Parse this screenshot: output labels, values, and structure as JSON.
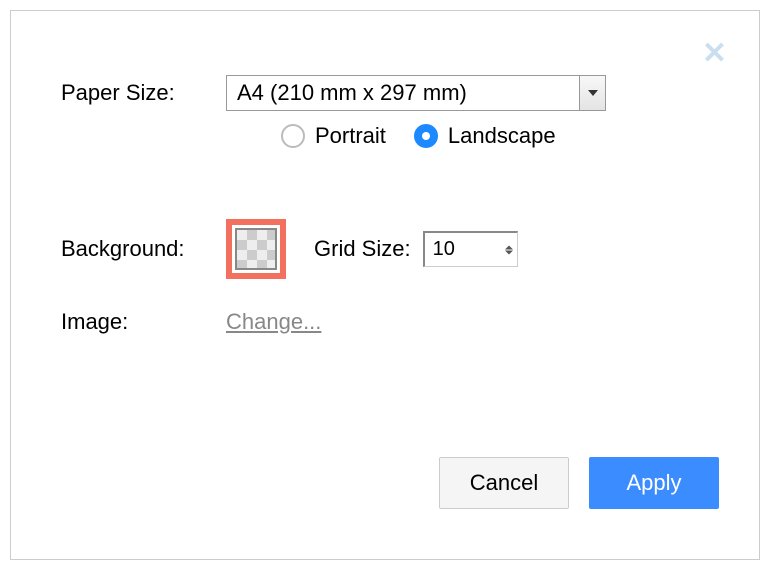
{
  "labels": {
    "paper_size": "Paper Size:",
    "background": "Background:",
    "grid_size": "Grid Size:",
    "image": "Image:"
  },
  "paper_size_value": "A4 (210 mm x 297 mm)",
  "orientation": {
    "portrait": "Portrait",
    "landscape": "Landscape",
    "selected": "landscape"
  },
  "grid_size_value": "10",
  "image_link": "Change...",
  "buttons": {
    "cancel": "Cancel",
    "apply": "Apply"
  }
}
